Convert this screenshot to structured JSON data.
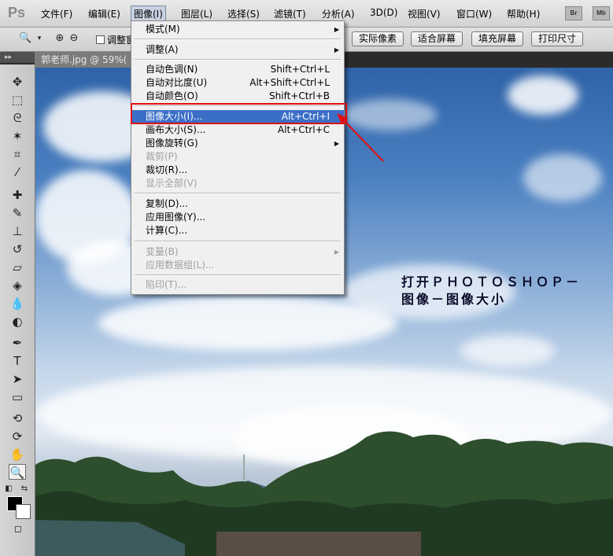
{
  "menubar": {
    "logo": "Ps",
    "items": [
      "文件(F)",
      "编辑(E)",
      "图像(I)",
      "图层(L)",
      "选择(S)",
      "滤镜(T)",
      "分析(A)",
      "3D(D)",
      "视图(V)",
      "窗口(W)",
      "帮助(H)"
    ],
    "right_buttons": [
      "Br",
      "Mb"
    ]
  },
  "options_bar": {
    "resize_label": "调整窗",
    "buttons": [
      "实际像素",
      "适合屏幕",
      "填充屏幕",
      "打印尺寸"
    ]
  },
  "document_tab": {
    "title": "郭老师.jpg @ 59%("
  },
  "collapse_strip": "▸▸",
  "image_menu": {
    "items": [
      {
        "label": "模式(M)",
        "shortcut": "",
        "submenu": true
      },
      {
        "label": "调整(A)",
        "shortcut": "",
        "submenu": true
      },
      {
        "label": "自动色调(N)",
        "shortcut": "Shift+Ctrl+L"
      },
      {
        "label": "自动对比度(U)",
        "shortcut": "Alt+Shift+Ctrl+L"
      },
      {
        "label": "自动颜色(O)",
        "shortcut": "Shift+Ctrl+B"
      },
      {
        "label": "图像大小(I)...",
        "shortcut": "Alt+Ctrl+I",
        "highlighted": true
      },
      {
        "label": "画布大小(S)...",
        "shortcut": "Alt+Ctrl+C"
      },
      {
        "label": "图像旋转(G)",
        "shortcut": "",
        "submenu": true
      },
      {
        "label": "裁剪(P)",
        "shortcut": "",
        "disabled": true
      },
      {
        "label": "裁切(R)...",
        "shortcut": ""
      },
      {
        "label": "显示全部(V)",
        "shortcut": "",
        "disabled": true
      },
      {
        "label": "复制(D)...",
        "shortcut": ""
      },
      {
        "label": "应用图像(Y)...",
        "shortcut": ""
      },
      {
        "label": "计算(C)...",
        "shortcut": ""
      },
      {
        "label": "变量(B)",
        "shortcut": "",
        "submenu": true,
        "disabled": true
      },
      {
        "label": "应用数据组(L)...",
        "shortcut": "",
        "disabled": true
      },
      {
        "label": "陷印(T)...",
        "shortcut": "",
        "disabled": true
      }
    ]
  },
  "overlay_text": "打开ＰＨＯＴＯＳＨＯＰ－图像－图像大小",
  "colors": {
    "highlight": "#3b6fc7",
    "annotation": "#e01010"
  }
}
